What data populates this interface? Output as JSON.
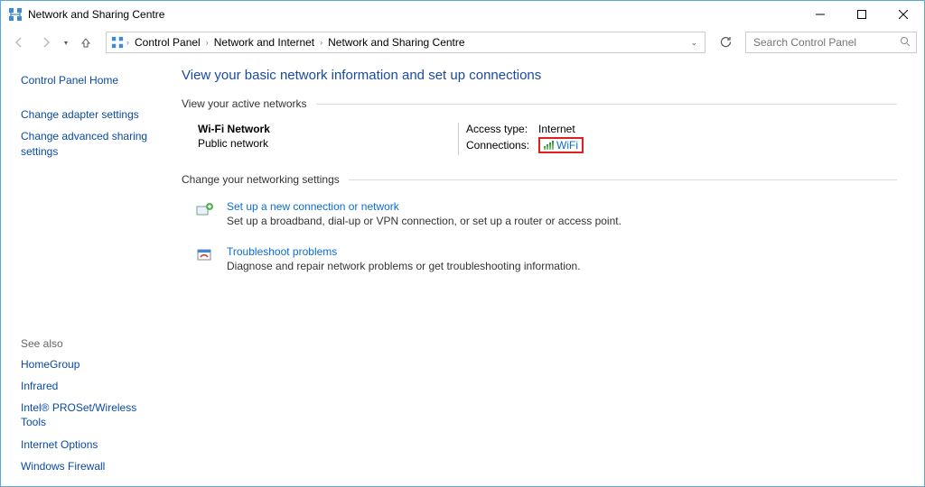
{
  "window": {
    "title": "Network and Sharing Centre"
  },
  "breadcrumbs": {
    "items": [
      "Control Panel",
      "Network and Internet",
      "Network and Sharing Centre"
    ]
  },
  "search": {
    "placeholder": "Search Control Panel"
  },
  "sidebar": {
    "home": "Control Panel Home",
    "links": [
      "Change adapter settings",
      "Change advanced sharing settings"
    ],
    "see_also_label": "See also",
    "see_also": [
      "HomeGroup",
      "Infrared",
      "Intel® PROSet/Wireless Tools",
      "Internet Options",
      "Windows Firewall"
    ]
  },
  "content": {
    "heading": "View your basic network information and set up connections",
    "active_section": "View your active networks",
    "change_section": "Change your networking settings",
    "network": {
      "name": "Wi-Fi Network",
      "type": "Public network",
      "access_label": "Access type:",
      "access_value": "Internet",
      "conn_label": "Connections:",
      "conn_value": "WiFi"
    },
    "tasks": [
      {
        "title": "Set up a new connection or network",
        "desc": "Set up a broadband, dial-up or VPN connection, or set up a router or access point."
      },
      {
        "title": "Troubleshoot problems",
        "desc": "Diagnose and repair network problems or get troubleshooting information."
      }
    ]
  }
}
